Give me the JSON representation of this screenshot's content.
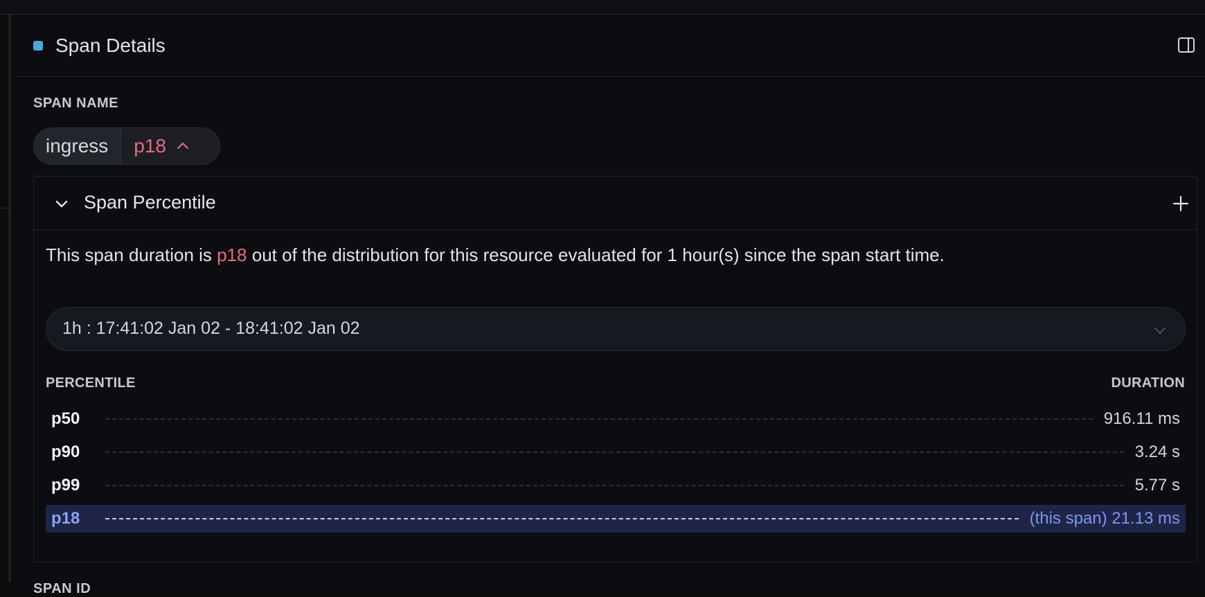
{
  "panel": {
    "title": "Span Details",
    "status_color": "#4aa8d8",
    "toggle_icon": "sidebar-toggle-icon"
  },
  "span_name": {
    "label": "SPAN NAME",
    "name": "ingress",
    "percentile": "p18",
    "percentile_color": "#e86b80"
  },
  "percentile_card": {
    "title": "Span Percentile",
    "description_before": "This span duration is ",
    "description_highlight": "p18",
    "description_after": " out of the distribution for this resource evaluated for 1 hour(s) since the span start time.",
    "range": "1h : 17:41:02 Jan 02 - 18:41:02 Jan 02",
    "col_left": "PERCENTILE",
    "col_right": "DURATION",
    "rows": [
      {
        "p": "p50",
        "duration": "916.11 ms"
      },
      {
        "p": "p90",
        "duration": "3.24 s"
      },
      {
        "p": "p99",
        "duration": "5.77 s"
      }
    ],
    "current": {
      "p": "p18",
      "duration": "(this span) 21.13 ms"
    }
  },
  "next_section_label": "SPAN ID"
}
